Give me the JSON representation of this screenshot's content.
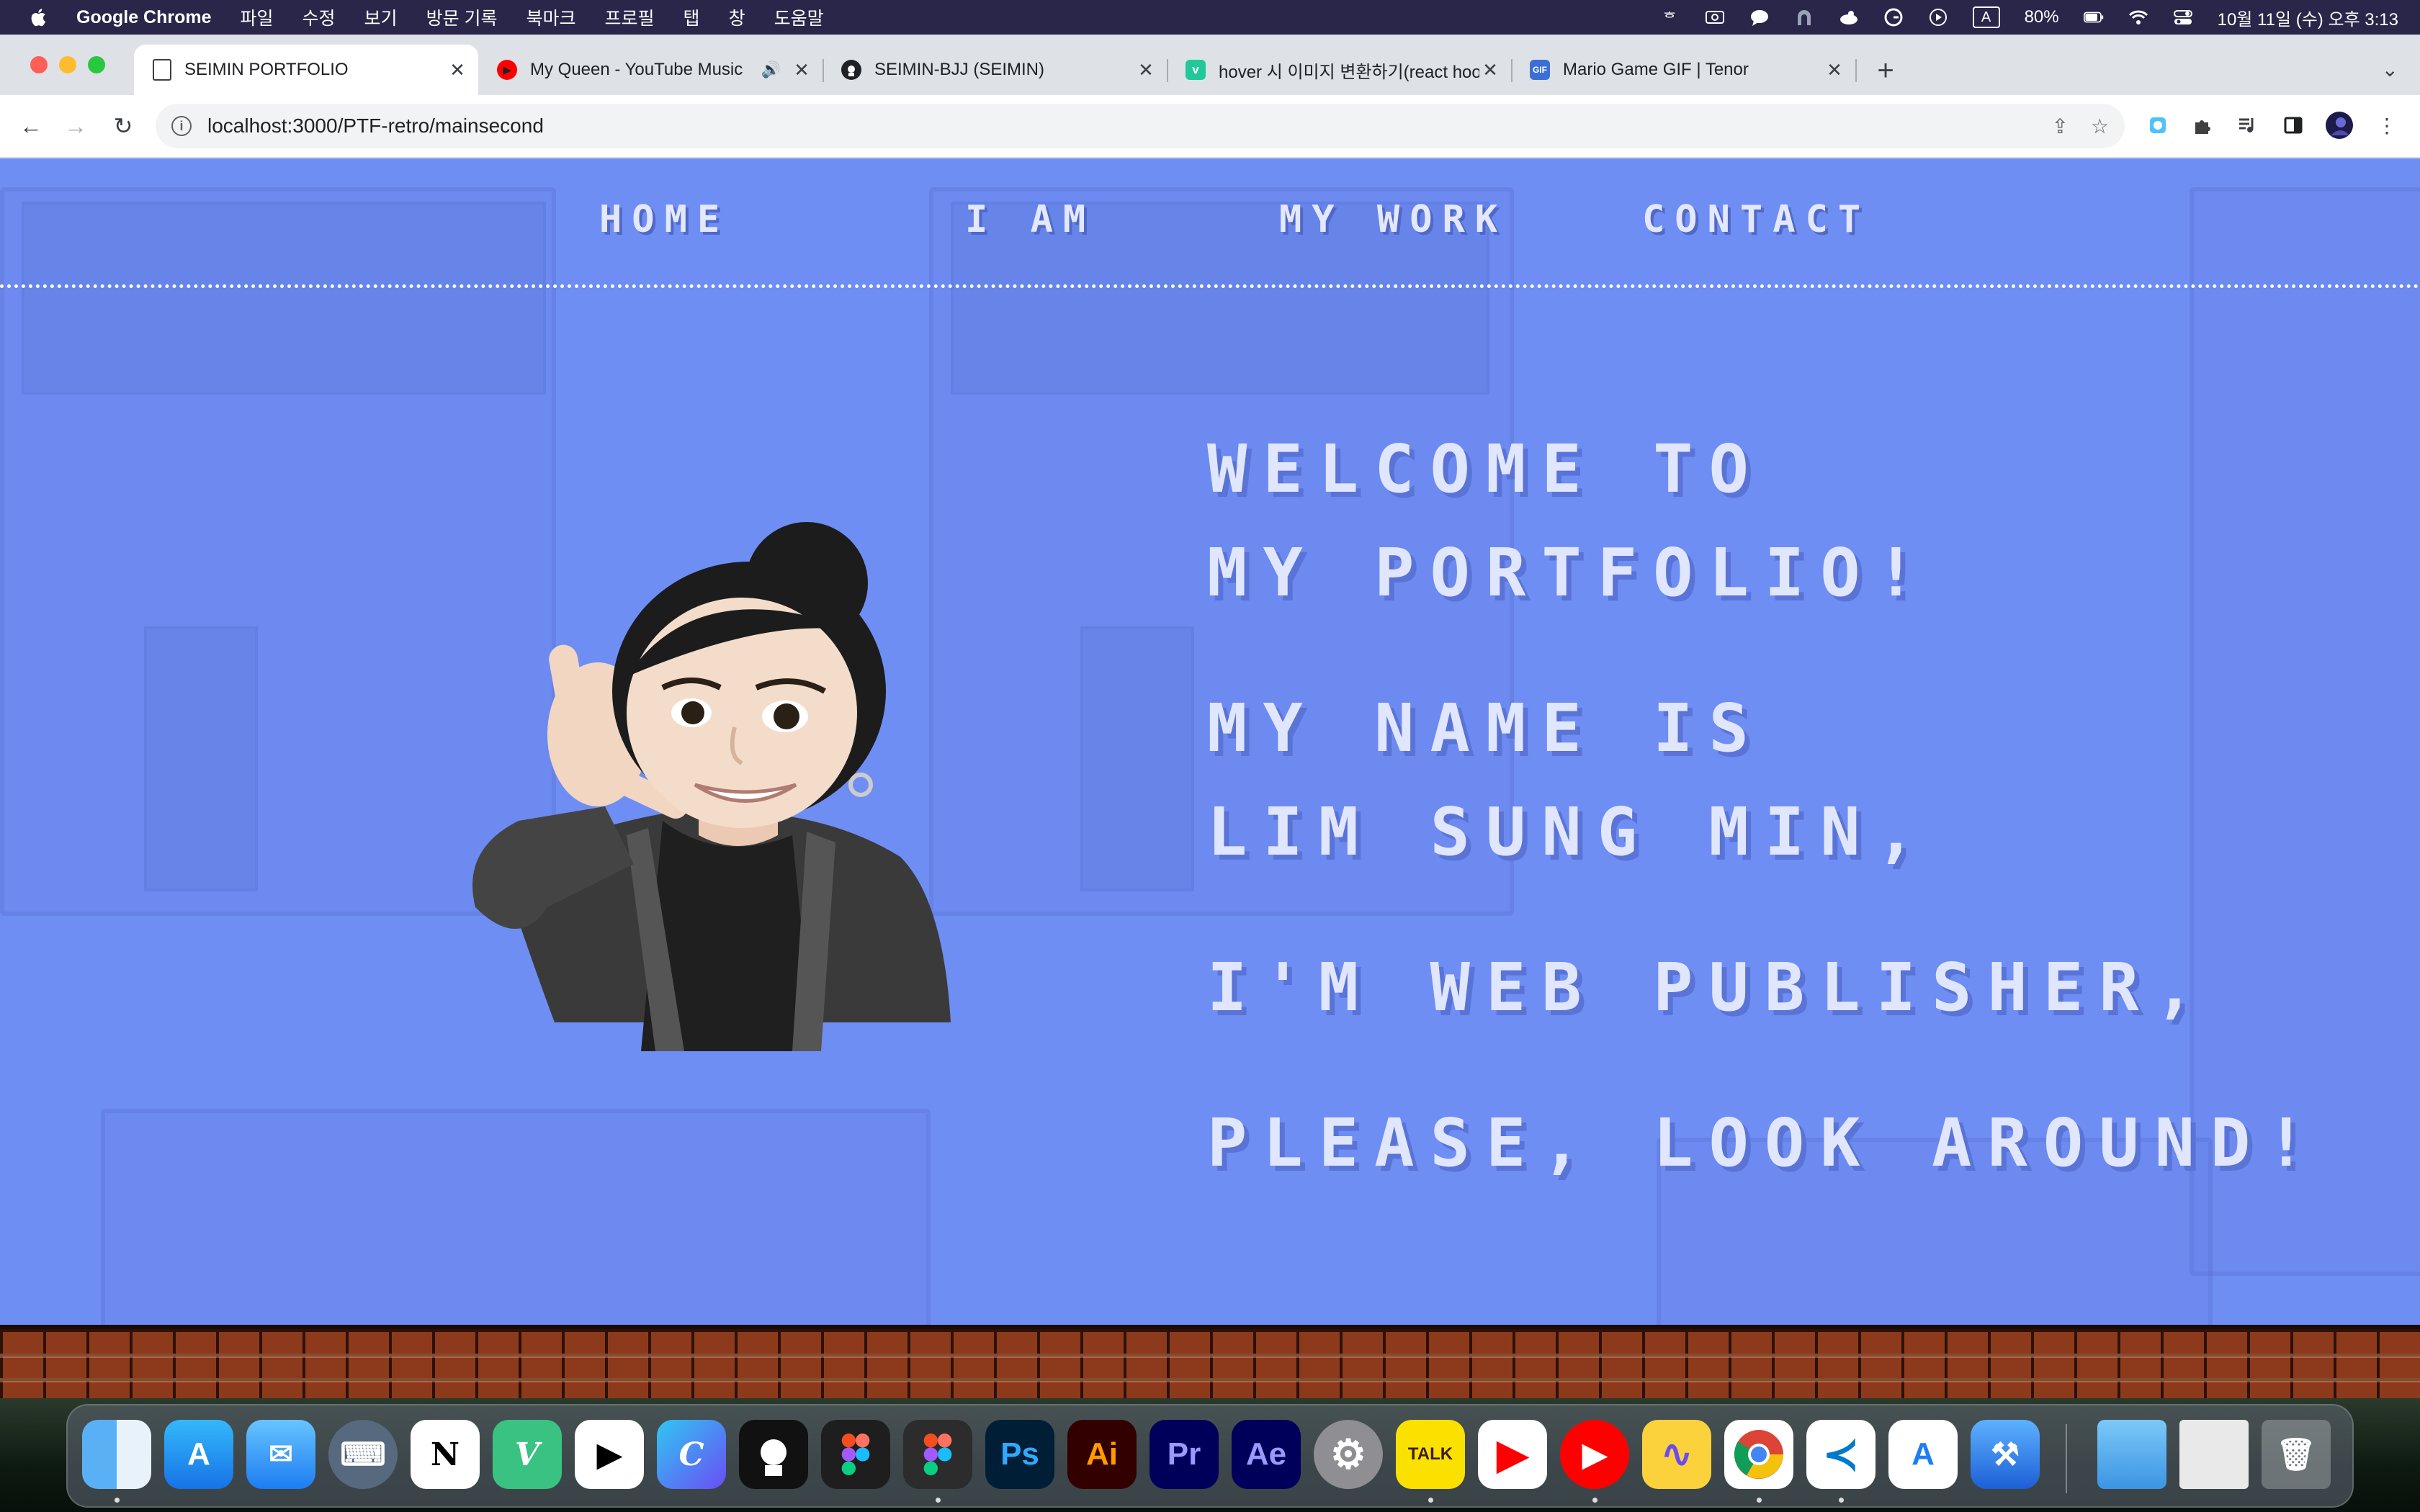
{
  "menubar": {
    "app_name": "Google Chrome",
    "menus": [
      "파일",
      "수정",
      "보기",
      "방문 기록",
      "북마크",
      "프로필",
      "탭",
      "창",
      "도움말"
    ],
    "battery": "80%",
    "input_indicator": "A",
    "datetime": "10월 11일 (수) 오후 3:13"
  },
  "browser": {
    "tabs": [
      {
        "title": "SEIMIN PORTFOLIO",
        "icon": "page-icon",
        "active": true
      },
      {
        "title": "My Queen - YouTube Music",
        "icon": "youtube-music-icon",
        "audio": true
      },
      {
        "title": "SEIMIN-BJJ (SEIMIN)",
        "icon": "github-icon"
      },
      {
        "title": "hover 시 이미지 변환하기(react hooks",
        "icon": "velog-icon"
      },
      {
        "title": "Mario Game GIF | Tenor",
        "icon": "tenor-gif-icon"
      }
    ],
    "new_tab_label": "+",
    "url": "localhost:3000/PTF-retro/mainsecond"
  },
  "page": {
    "nav": [
      "HOME",
      "I AM",
      "MY WORK",
      "CONTACT"
    ],
    "hero": {
      "line1": "WELCOME TO",
      "line2": "MY PORTFOLIO!",
      "line3": "MY NAME IS",
      "line4": "LIM SUNG MIN,",
      "line5": "I'M WEB PUBLISHER,",
      "line6": "PLEASE, LOOK AROUND!"
    },
    "colors": {
      "background": "#6f8ef3",
      "text": "#e1e6ff",
      "brick": "#8d3a1c"
    }
  },
  "dock": {
    "apps": [
      {
        "name": "Finder",
        "label": ""
      },
      {
        "name": "App Store",
        "label": ""
      },
      {
        "name": "Mail",
        "label": ""
      },
      {
        "name": "Keyboard",
        "label": ""
      },
      {
        "name": "Notion",
        "label": "N"
      },
      {
        "name": "Vectorize",
        "label": "V"
      },
      {
        "name": "Framer",
        "label": ""
      },
      {
        "name": "Craft",
        "label": "C"
      },
      {
        "name": "GitHub Desktop",
        "label": ""
      },
      {
        "name": "Figma",
        "label": ""
      },
      {
        "name": "Figma Beta",
        "label": ""
      },
      {
        "name": "Photoshop",
        "label": "Ps"
      },
      {
        "name": "Illustrator",
        "label": "Ai"
      },
      {
        "name": "Premiere Pro",
        "label": "Pr"
      },
      {
        "name": "After Effects",
        "label": "Ae"
      },
      {
        "name": "System Settings",
        "label": ""
      },
      {
        "name": "KakaoTalk",
        "label": "TALK"
      },
      {
        "name": "YouTube",
        "label": ""
      },
      {
        "name": "YouTube Music",
        "label": ""
      },
      {
        "name": "Audio App",
        "label": ""
      },
      {
        "name": "Chrome",
        "label": ""
      },
      {
        "name": "VS Code",
        "label": ""
      },
      {
        "name": "App Store Connect",
        "label": ""
      },
      {
        "name": "Xcode",
        "label": ""
      },
      {
        "name": "Folder",
        "label": ""
      },
      {
        "name": "Downloads Stack",
        "label": ""
      },
      {
        "name": "Trash",
        "label": ""
      }
    ]
  }
}
